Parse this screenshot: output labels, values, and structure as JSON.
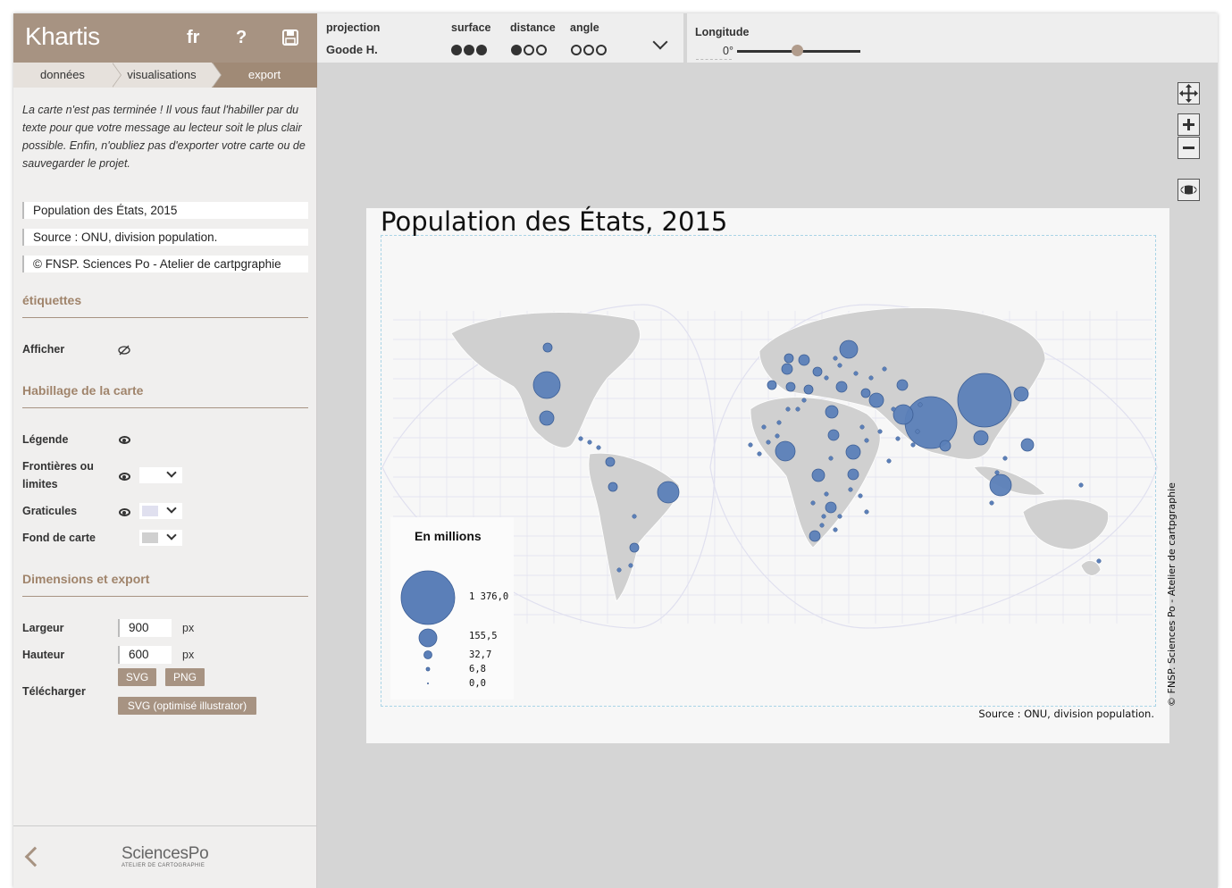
{
  "app": {
    "name": "Khartis",
    "lang": "fr",
    "help": "?"
  },
  "steps": [
    "données",
    "visualisations",
    "export"
  ],
  "intro_text": "La carte n'est pas terminée ! Il vous faut l'habiller par du texte pour que votre message au lecteur soit le plus clair possible. Enfin, n'oubliez pas d'exporter votre carte ou de sauvegarder le projet.",
  "fields": {
    "title": "Population des États, 2015",
    "source": "Source : ONU, division population.",
    "author": "© FNSP. Sciences Po - Atelier de cartpgraphie"
  },
  "labels_section": {
    "title": "étiquettes",
    "show_label": "Afficher"
  },
  "dressing_section": {
    "title": "Habillage de la carte",
    "legend": "Légende",
    "borders": "Frontières ou limites",
    "graticules": "Graticules",
    "background": "Fond de carte",
    "graticule_color": "#e0e0ef",
    "background_color": "#d0d0d0"
  },
  "export_section": {
    "title": "Dimensions et export",
    "width_label": "Largeur",
    "width_value": "900",
    "height_label": "Hauteur",
    "height_value": "600",
    "unit": "px",
    "download_label": "Télécharger",
    "svg_button": "SVG",
    "png_button": "PNG",
    "svg_ai_button": "SVG (optimisé illustrator)"
  },
  "footer": {
    "logo_main": "SciencesPo",
    "logo_sub": "ATELIER DE CARTOGRAPHIE"
  },
  "toolbar": {
    "projection_label": "projection",
    "projection_value": "Goode H.",
    "surface_label": "surface",
    "surface_level": 3,
    "distance_label": "distance",
    "distance_level": 1,
    "angle_label": "angle",
    "angle_level": 0,
    "longitude_label": "Longitude",
    "longitude_value": "0°"
  },
  "map": {
    "title": "Population des États, 2015",
    "source": "Source : ONU, division population.",
    "credit": "© FNSP. Sciences Po - Atelier de cartpgraphie",
    "legend_title": "En millions",
    "legend_values": [
      "1 376,0",
      "155,5",
      "32,7",
      "6,8",
      "0,0"
    ],
    "symbol_color": "#5b7fb8",
    "land_color": "#d0d0d0",
    "graticule_color": "#e0e0ef"
  },
  "colors": {
    "brand": "#a79382",
    "accent_text": "#a0846b"
  }
}
